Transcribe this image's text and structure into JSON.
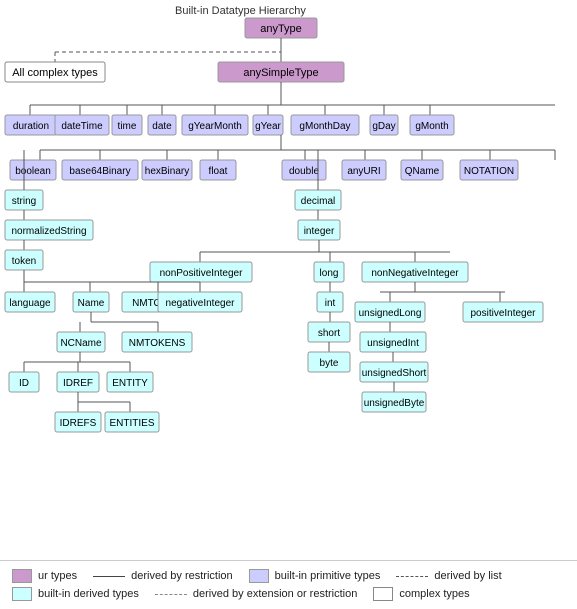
{
  "title": "Built-in Datatype Hierarchy",
  "legend": {
    "items": [
      {
        "label": "ur types",
        "color": "#cc99cc",
        "type": "box"
      },
      {
        "label": "built-in primitive types",
        "color": "#ccccff",
        "type": "box"
      },
      {
        "label": "built-in derived types",
        "color": "#ccffff",
        "type": "box"
      },
      {
        "label": "complex types",
        "color": "#ffffff",
        "type": "box"
      },
      {
        "label": "derived by restriction",
        "line": "solid"
      },
      {
        "label": "derived by list",
        "line": "dash"
      },
      {
        "label": "derived by extension or restriction",
        "line": "dashdot"
      }
    ]
  }
}
